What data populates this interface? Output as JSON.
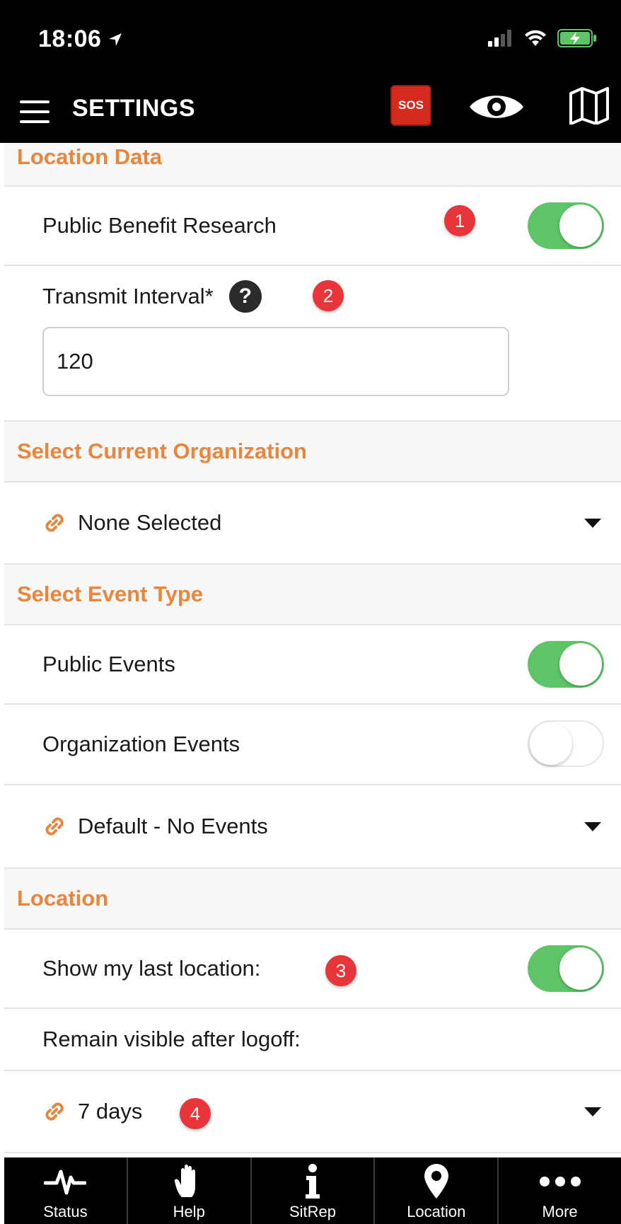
{
  "status_bar": {
    "time": "18:06"
  },
  "nav": {
    "title": "SETTINGS",
    "sos_label": "SOS"
  },
  "sections": {
    "location_data": {
      "header": "Location Data",
      "public_benefit_label": "Public Benefit Research",
      "public_benefit_on": true,
      "transmit_label": "Transmit Interval*",
      "transmit_help": "?",
      "transmit_value": "120"
    },
    "organization": {
      "header": "Select Current Organization",
      "selected": "None Selected"
    },
    "event_type": {
      "header": "Select Event Type",
      "public_events_label": "Public Events",
      "public_events_on": true,
      "org_events_label": "Organization Events",
      "org_events_on": false,
      "event_selected": "Default - No Events"
    },
    "location": {
      "header": "Location",
      "show_last_label": "Show my last location:",
      "show_last_on": true,
      "remain_label": "Remain visible after logoff:",
      "remain_selected": "7 days"
    }
  },
  "badges": [
    "1",
    "2",
    "3",
    "4"
  ],
  "tabs": [
    {
      "label": "Status",
      "icon": "pulse-icon"
    },
    {
      "label": "Help",
      "icon": "hand-icon"
    },
    {
      "label": "SitRep",
      "icon": "info-icon"
    },
    {
      "label": "Location",
      "icon": "map-pin-icon"
    },
    {
      "label": "More",
      "icon": "more-dots-icon"
    }
  ],
  "colors": {
    "accent": "#e7863c",
    "toggle_on": "#5fc468",
    "badge": "#e8353a",
    "sos": "#d42b1e"
  }
}
